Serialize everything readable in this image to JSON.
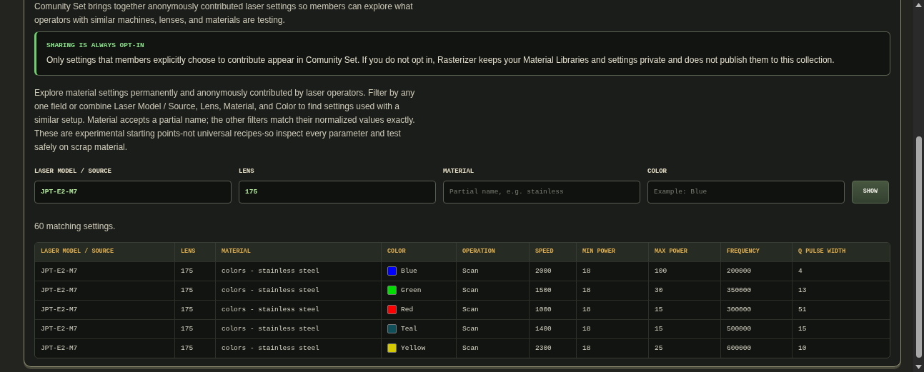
{
  "intro": "Comunity Set brings together anonymously contributed laser settings so members can explore what operators with similar machines, lenses, and materials are testing.",
  "callout": {
    "title": "SHARING IS ALWAYS OPT-IN",
    "text": "Only settings that members explicitly choose to contribute appear in Comunity Set. If you do not opt in, Rasterizer keeps your Material Libraries and settings private and does not publish them to this collection."
  },
  "description": "Explore material settings permanently and anonymously contributed by laser operators. Filter by any one field or combine Laser Model / Source, Lens, Material, and Color to find settings used with a similar setup. Material accepts a partial name; the other filters match their normalized values exactly. These are experimental starting points-not universal recipes-so inspect every parameter and test safely on scrap material.",
  "filters": [
    {
      "label": "LASER MODEL / SOURCE",
      "value": "JPT-E2-M7"
    },
    {
      "label": "LENS",
      "value": "175"
    },
    {
      "label": "MATERIAL",
      "placeholder": "Partial name, e.g. stainless"
    },
    {
      "label": "COLOR",
      "placeholder": "Example: Blue"
    }
  ],
  "show_button": "SHOW",
  "result_count": "60 matching settings.",
  "table": {
    "columns": [
      "LASER MODEL / SOURCE",
      "LENS",
      "MATERIAL",
      "COLOR",
      "OPERATION",
      "SPEED",
      "MIN POWER",
      "MAX POWER",
      "FREQUENCY",
      "Q PULSE WIDTH"
    ],
    "rows": [
      {
        "cells": [
          "JPT-E2-M7",
          "175",
          "colors - stainless steel",
          "Blue",
          "Scan",
          "2000",
          "18",
          "100",
          "200000",
          "4"
        ],
        "color": "#0000ff"
      },
      {
        "cells": [
          "JPT-E2-M7",
          "175",
          "colors - stainless steel",
          "Green",
          "Scan",
          "1500",
          "18",
          "30",
          "350000",
          "13"
        ],
        "color": "#00dd00"
      },
      {
        "cells": [
          "JPT-E2-M7",
          "175",
          "colors - stainless steel",
          "Red",
          "Scan",
          "1000",
          "18",
          "15",
          "300000",
          "51"
        ],
        "color": "#ff0000"
      },
      {
        "cells": [
          "JPT-E2-M7",
          "175",
          "colors - stainless steel",
          "Teal",
          "Scan",
          "1400",
          "18",
          "15",
          "500000",
          "15"
        ],
        "color": "#0f4f5a"
      },
      {
        "cells": [
          "JPT-E2-M7",
          "175",
          "colors - stainless steel",
          "Yellow",
          "Scan",
          "2300",
          "18",
          "25",
          "600000",
          "10"
        ],
        "color": "#d4c800"
      }
    ]
  }
}
